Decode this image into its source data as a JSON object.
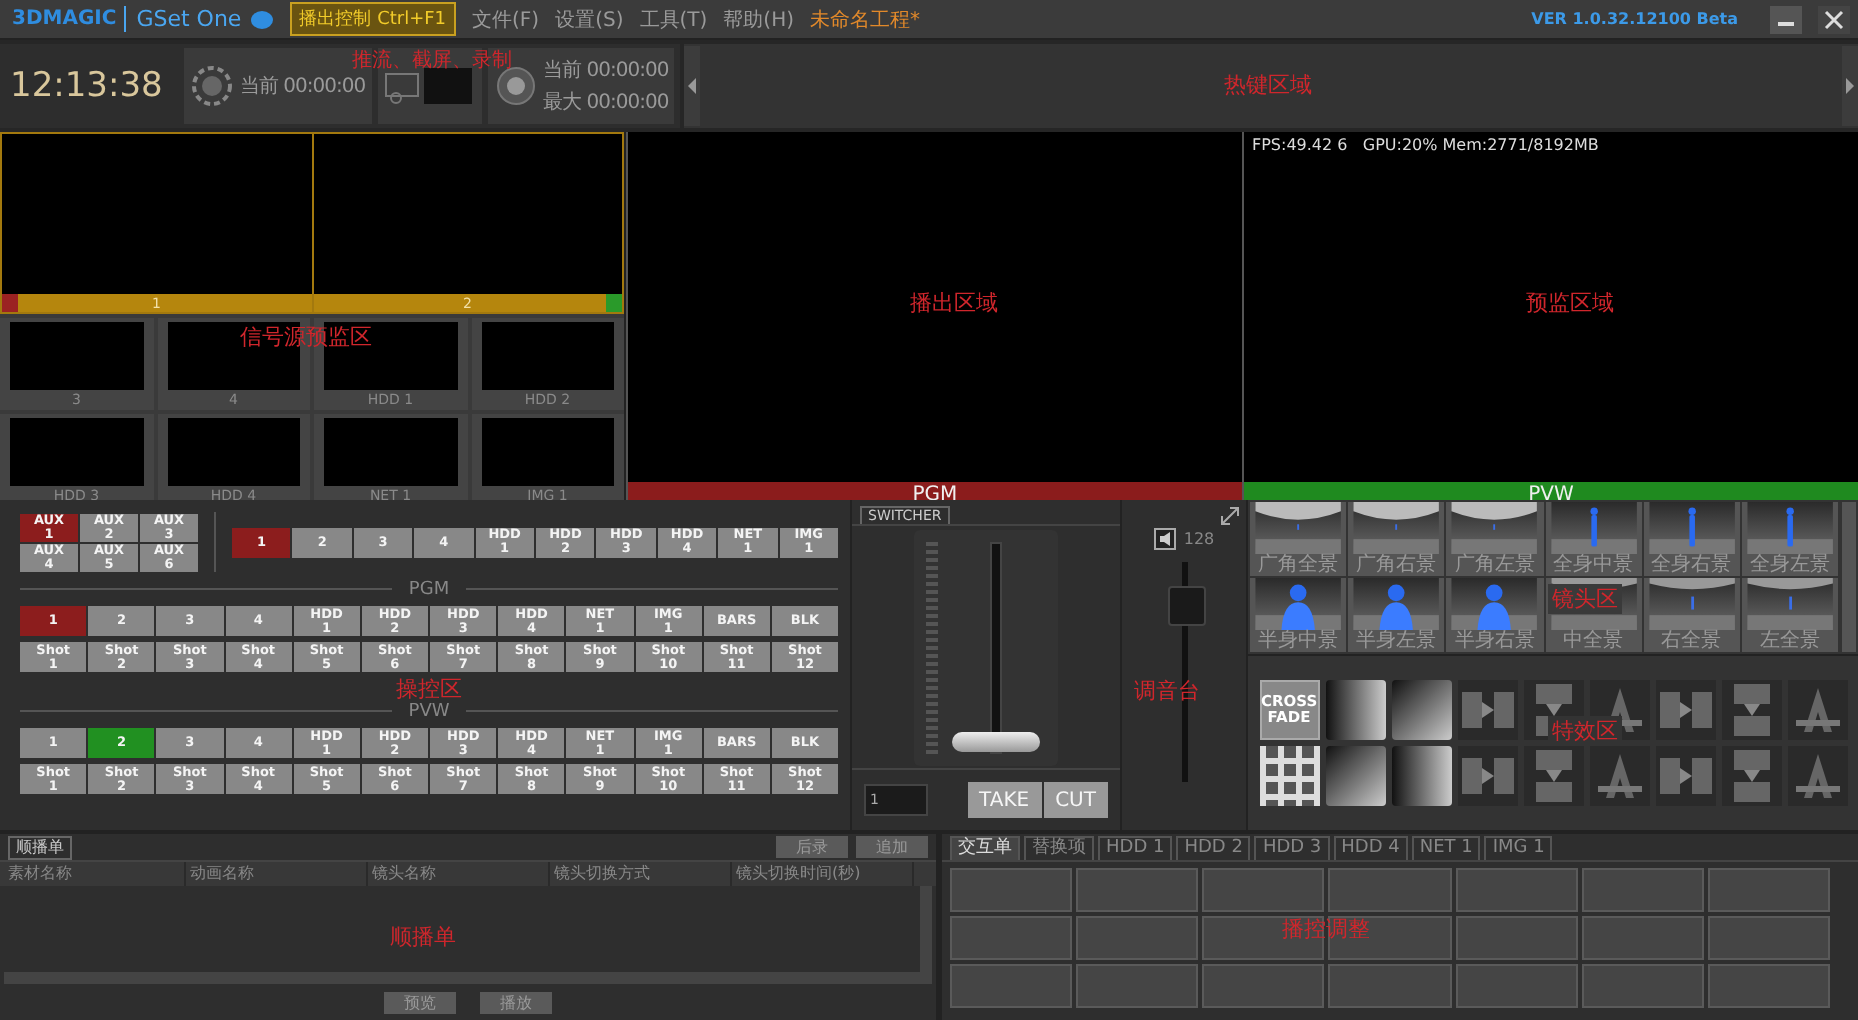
{
  "title_bar": {
    "logo": "3DMAGIC",
    "product": "GSet One",
    "mode_button": "播出控制 Ctrl+F1",
    "menu": [
      "文件(F)",
      "设置(S)",
      "工具(T)",
      "帮助(H)"
    ],
    "project": "未命名工程*",
    "version": "VER 1.0.32.12100 Beta"
  },
  "recorder": {
    "clock": "12:13:38",
    "stream": {
      "current": "当前 00:00:00"
    },
    "record": {
      "current": "当前 00:00:00",
      "max": "最大 00:00:00"
    },
    "note": "推流、截屏、录制"
  },
  "hotkeys": {
    "note": "热键区域"
  },
  "sources": {
    "note": "信号源预监区",
    "tiles": [
      {
        "label": "1",
        "kind": "large",
        "on_program": true,
        "on_preview": false
      },
      {
        "label": "2",
        "kind": "large",
        "on_program": false,
        "on_preview": true
      },
      {
        "label": "3",
        "kind": "small",
        "on_program": false,
        "on_preview": false
      },
      {
        "label": "4",
        "kind": "small",
        "on_program": false,
        "on_preview": false
      },
      {
        "label": "HDD 1",
        "kind": "small",
        "on_program": false,
        "on_preview": false
      },
      {
        "label": "HDD 2",
        "kind": "small",
        "on_program": false,
        "on_preview": false
      },
      {
        "label": "HDD 3",
        "kind": "small",
        "on_program": false,
        "on_preview": false
      },
      {
        "label": "HDD 4",
        "kind": "small",
        "on_program": false,
        "on_preview": false
      },
      {
        "label": "NET 1",
        "kind": "small",
        "on_program": false,
        "on_preview": false
      },
      {
        "label": "IMG 1",
        "kind": "small",
        "on_program": false,
        "on_preview": false
      }
    ]
  },
  "program": {
    "note": "播出区域",
    "label": "PGM"
  },
  "preview": {
    "stats": "FPS:49.42 6   GPU:20% Mem:2771/8192MB",
    "note": "预监区域",
    "label": "PVW"
  },
  "controls": {
    "note": "操控区",
    "aux": [
      {
        "label": "AUX 1",
        "selected": true
      },
      {
        "label": "AUX 2",
        "selected": false
      },
      {
        "label": "AUX 3",
        "selected": false
      },
      {
        "label": "AUX 4",
        "selected": false
      },
      {
        "label": "AUX 5",
        "selected": false
      },
      {
        "label": "AUX 6",
        "selected": false
      }
    ],
    "aux_sources": [
      {
        "label": "1",
        "selected": true
      },
      {
        "label": "2",
        "selected": false
      },
      {
        "label": "3",
        "selected": false
      },
      {
        "label": "4",
        "selected": false
      },
      {
        "label": "HDD 1",
        "selected": false
      },
      {
        "label": "HDD 2",
        "selected": false
      },
      {
        "label": "HDD 3",
        "selected": false
      },
      {
        "label": "HDD 4",
        "selected": false
      },
      {
        "label": "NET 1",
        "selected": false
      },
      {
        "label": "IMG 1",
        "selected": false
      }
    ],
    "pgm_label": "PGM",
    "pgm_sources": [
      {
        "label": "1",
        "selected": true
      },
      {
        "label": "2",
        "selected": false
      },
      {
        "label": "3",
        "selected": false
      },
      {
        "label": "4",
        "selected": false
      },
      {
        "label": "HDD 1",
        "selected": false
      },
      {
        "label": "HDD 2",
        "selected": false
      },
      {
        "label": "HDD 3",
        "selected": false
      },
      {
        "label": "HDD 4",
        "selected": false
      },
      {
        "label": "NET 1",
        "selected": false
      },
      {
        "label": "IMG 1",
        "selected": false
      },
      {
        "label": "BARS",
        "selected": false
      },
      {
        "label": "BLK",
        "selected": false
      }
    ],
    "pgm_shots": [
      "Shot 1",
      "Shot 2",
      "Shot 3",
      "Shot 4",
      "Shot 5",
      "Shot 6",
      "Shot 7",
      "Shot 8",
      "Shot 9",
      "Shot 10",
      "Shot 11",
      "Shot 12"
    ],
    "pvw_label": "PVW",
    "pvw_sources": [
      {
        "label": "1",
        "selected": false
      },
      {
        "label": "2",
        "selected": true
      },
      {
        "label": "3",
        "selected": false
      },
      {
        "label": "4",
        "selected": false
      },
      {
        "label": "HDD 1",
        "selected": false
      },
      {
        "label": "HDD 2",
        "selected": false
      },
      {
        "label": "HDD 3",
        "selected": false
      },
      {
        "label": "HDD 4",
        "selected": false
      },
      {
        "label": "NET 1",
        "selected": false
      },
      {
        "label": "IMG 1",
        "selected": false
      },
      {
        "label": "BARS",
        "selected": false
      },
      {
        "label": "BLK",
        "selected": false
      }
    ],
    "pvw_shots": [
      "Shot 1",
      "Shot 2",
      "Shot 3",
      "Shot 4",
      "Shot 5",
      "Shot 6",
      "Shot 7",
      "Shot 8",
      "Shot 9",
      "Shot 10",
      "Shot 11",
      "Shot 12"
    ]
  },
  "switcher": {
    "tab": "SWITCHER",
    "tbar": {
      "level": 0
    },
    "input": "1",
    "buttons": [
      "TAKE",
      "CUT"
    ]
  },
  "mixer": {
    "volume": "128",
    "fader": {
      "level": 0.85
    },
    "note": "调音台"
  },
  "shots": {
    "note": "镜头区",
    "items": [
      {
        "label": "广角全景",
        "kind": "wide"
      },
      {
        "label": "广角右景",
        "kind": "wide"
      },
      {
        "label": "广角左景",
        "kind": "wide"
      },
      {
        "label": "全身中景",
        "kind": "full"
      },
      {
        "label": "全身右景",
        "kind": "full"
      },
      {
        "label": "全身左景",
        "kind": "full"
      },
      {
        "label": "半身中景",
        "kind": "half"
      },
      {
        "label": "半身左景",
        "kind": "half"
      },
      {
        "label": "半身右景",
        "kind": "half"
      },
      {
        "label": "中全景",
        "kind": "medium"
      },
      {
        "label": "右全景",
        "kind": "medium"
      },
      {
        "label": "左全景",
        "kind": "medium"
      }
    ]
  },
  "effects": {
    "note": "特效区",
    "items": [
      {
        "kind": "text",
        "label": "CROSS FADE"
      },
      {
        "kind": "gradient"
      },
      {
        "kind": "gradient"
      },
      {
        "kind": "wipe"
      },
      {
        "kind": "wipe"
      },
      {
        "kind": "wipe"
      },
      {
        "kind": "wipe"
      },
      {
        "kind": "wipe"
      },
      {
        "kind": "wipe"
      },
      {
        "kind": "noise"
      },
      {
        "kind": "gradient"
      },
      {
        "kind": "gradient"
      },
      {
        "kind": "wipe"
      },
      {
        "kind": "wipe"
      },
      {
        "kind": "wipe"
      },
      {
        "kind": "wipe"
      },
      {
        "kind": "wipe"
      },
      {
        "kind": "wipe"
      }
    ]
  },
  "playlist": {
    "tab": "顺播单",
    "buttons": [
      "后录",
      "追加"
    ],
    "columns": [
      "素材名称",
      "动画名称",
      "镜头名称",
      "镜头切换方式",
      "镜头切换时间(秒)"
    ],
    "note": "顺播单",
    "footer_buttons": [
      "预览",
      "播放"
    ]
  },
  "broadcast": {
    "tabs": [
      {
        "label": "交互单",
        "selected": true
      },
      {
        "label": "替换项",
        "selected": false
      },
      {
        "label": "HDD 1",
        "selected": false
      },
      {
        "label": "HDD 2",
        "selected": false
      },
      {
        "label": "HDD 3",
        "selected": false
      },
      {
        "label": "HDD 4",
        "selected": false
      },
      {
        "label": "NET 1",
        "selected": false
      },
      {
        "label": "IMG 1",
        "selected": false
      }
    ],
    "note": "播控调整"
  }
}
